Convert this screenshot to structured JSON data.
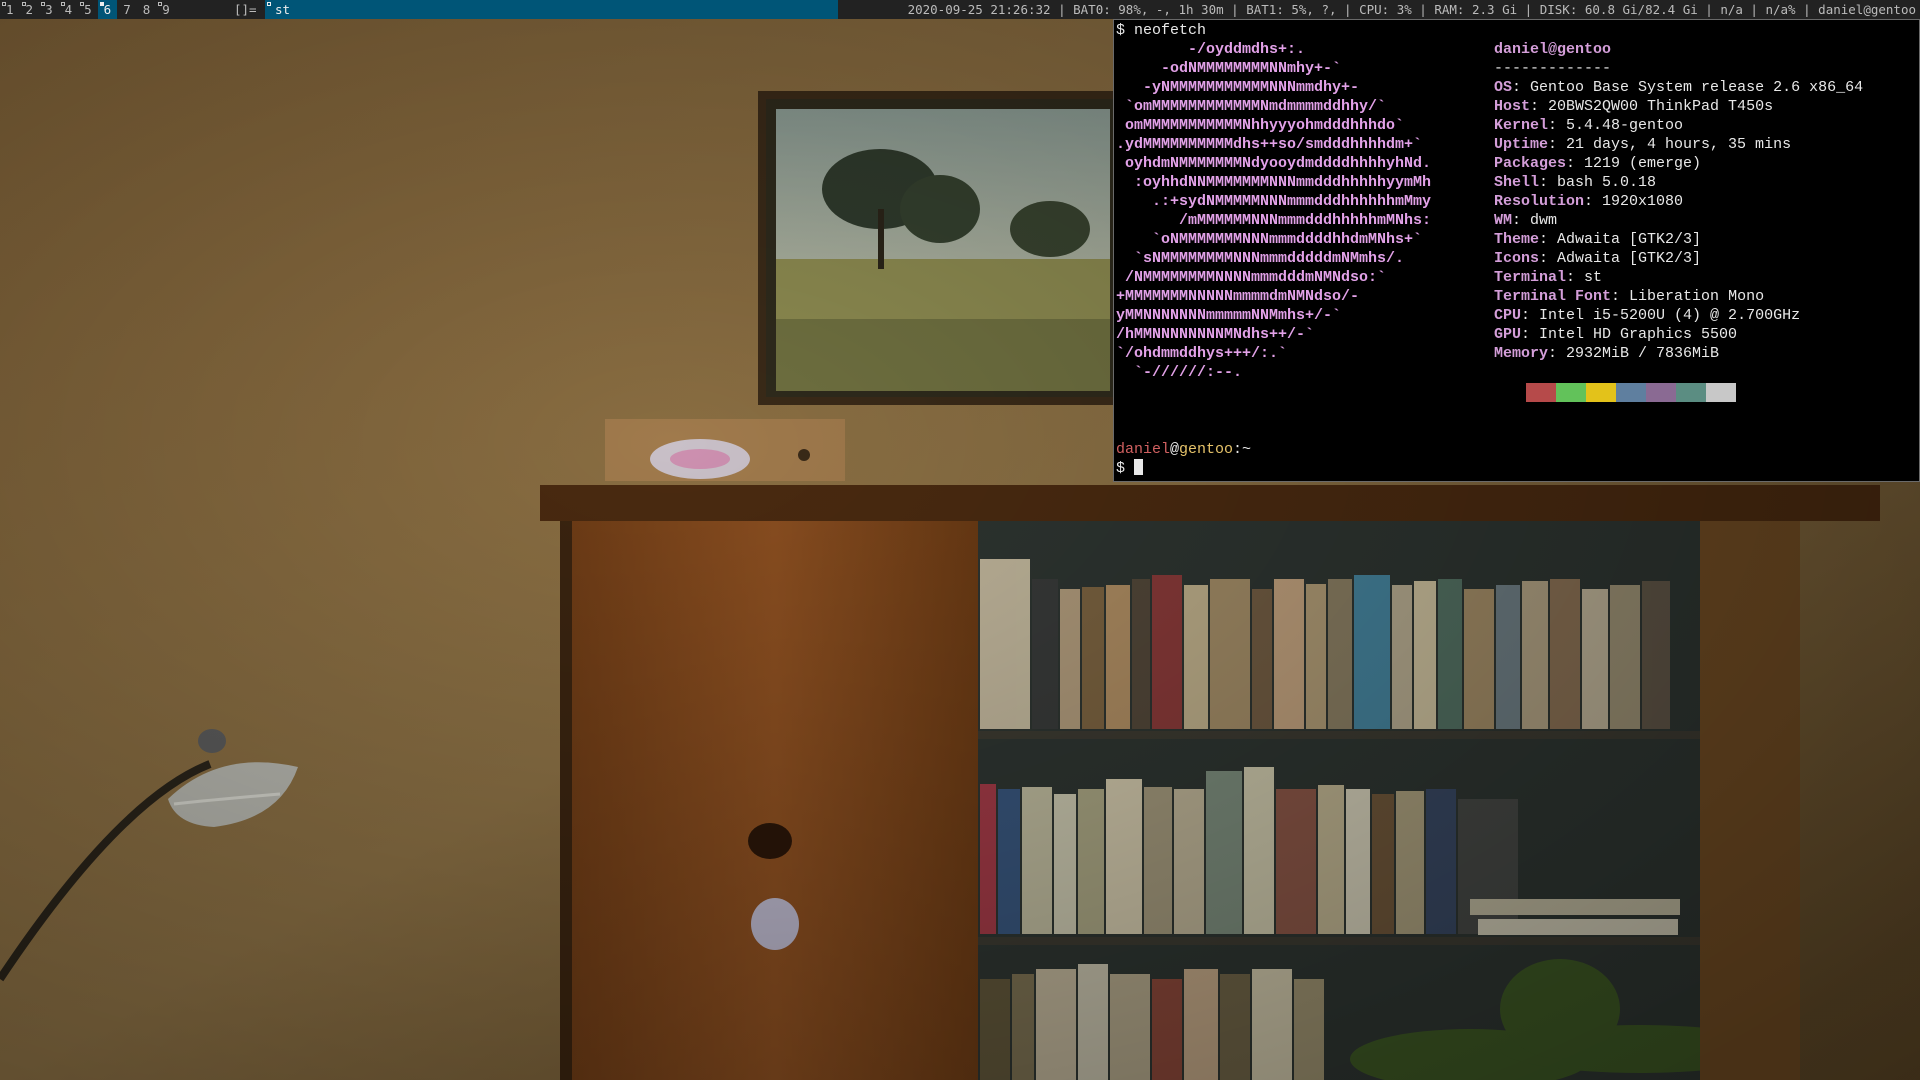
{
  "bar": {
    "tags": [
      {
        "label": "1",
        "occupied": true,
        "selected": false
      },
      {
        "label": "2",
        "occupied": true,
        "selected": false
      },
      {
        "label": "3",
        "occupied": true,
        "selected": false
      },
      {
        "label": "4",
        "occupied": true,
        "selected": false
      },
      {
        "label": "5",
        "occupied": true,
        "selected": false
      },
      {
        "label": "6",
        "occupied": true,
        "selected": true
      },
      {
        "label": "7",
        "occupied": false,
        "selected": false
      },
      {
        "label": "8",
        "occupied": false,
        "selected": false
      },
      {
        "label": "9",
        "occupied": true,
        "selected": false
      }
    ],
    "layout_symbol": "[]=",
    "window_title": "st",
    "status": "2020-09-25 21:26:32 | BAT0: 98%, -, 1h 30m | BAT1: 5%, ?,  | CPU: 3% | RAM: 2.3 Gi | DISK: 60.8 Gi/82.4 Gi | n/a | n/a% | daniel@gentoo",
    "colors": {
      "background": "#222222",
      "selected": "#005577",
      "text": "#bbbbbb"
    }
  },
  "terminal": {
    "command_line": "$ neofetch",
    "logo_color": "#e2a1e8",
    "logo": [
      "        -/oyddmdhs+:.",
      "     -odNMMMMMMMMNNmhy+-`",
      "   -yNMMMMMMMMMMMNNNmmdhy+-",
      " `omMMMMMMMMMMMMNmdmmmmddhhy/`",
      " omMMMMMMMMMMMNhhyyyohmdddhhhdo`",
      ".ydMMMMMMMMMMdhs++so/smdddhhhhdm+`",
      " oyhdmNMMMMMMMNdyooydmddddhhhhyhNd.",
      "  :oyhhdNNMMMMMMMNNNmmdddhhhhhyymMh",
      "    .:+sydNMMMMMNNNmmmdddhhhhhhmMmy",
      "       /mMMMMMMNNNmmmdddhhhhhmMNhs:",
      "    `oNMMMMMMMNNNmmmddddhhdmMNhs+`",
      "  `sNMMMMMMMMNNNmmmdddddmNMmhs/.",
      " /NMMMMMMMMNNNNmmmdddmNMNdso:`",
      "+MMMMMMMNNNNNmmmmdmNMNdso/-",
      "yMMNNNNNNNmmmmmNNMmhs+/-`",
      "/hMMNNNNNNNNMNdhs++/-`",
      "`/ohdmmddhys+++/:.`",
      "  `-//////:--."
    ],
    "user_host": "daniel@gentoo",
    "separator": "-------------",
    "info": [
      {
        "key": "OS",
        "value": "Gentoo Base System release 2.6 x86_64"
      },
      {
        "key": "Host",
        "value": "20BWS2QW00 ThinkPad T450s"
      },
      {
        "key": "Kernel",
        "value": "5.4.48-gentoo"
      },
      {
        "key": "Uptime",
        "value": "21 days, 4 hours, 35 mins"
      },
      {
        "key": "Packages",
        "value": "1219 (emerge)"
      },
      {
        "key": "Shell",
        "value": "bash 5.0.18"
      },
      {
        "key": "Resolution",
        "value": "1920x1080"
      },
      {
        "key": "WM",
        "value": "dwm"
      },
      {
        "key": "Theme",
        "value": "Adwaita [GTK2/3]"
      },
      {
        "key": "Icons",
        "value": "Adwaita [GTK2/3]"
      },
      {
        "key": "Terminal",
        "value": "st"
      },
      {
        "key": "Terminal Font",
        "value": "Liberation Mono"
      },
      {
        "key": "CPU",
        "value": "Intel i5-5200U (4) @ 2.700GHz"
      },
      {
        "key": "GPU",
        "value": "Intel HD Graphics 5500"
      },
      {
        "key": "Memory",
        "value": "2932MiB / 7836MiB"
      }
    ],
    "palette": [
      "#b64a4a",
      "#62c25a",
      "#e3c21a",
      "#5f7f9f",
      "#8a6a93",
      "#5b8d82",
      "#c8c8c8"
    ],
    "prompt": {
      "user": "daniel",
      "at": "@",
      "host": "gentoo",
      "path": ":~"
    },
    "prompt_symbol": "$ "
  }
}
